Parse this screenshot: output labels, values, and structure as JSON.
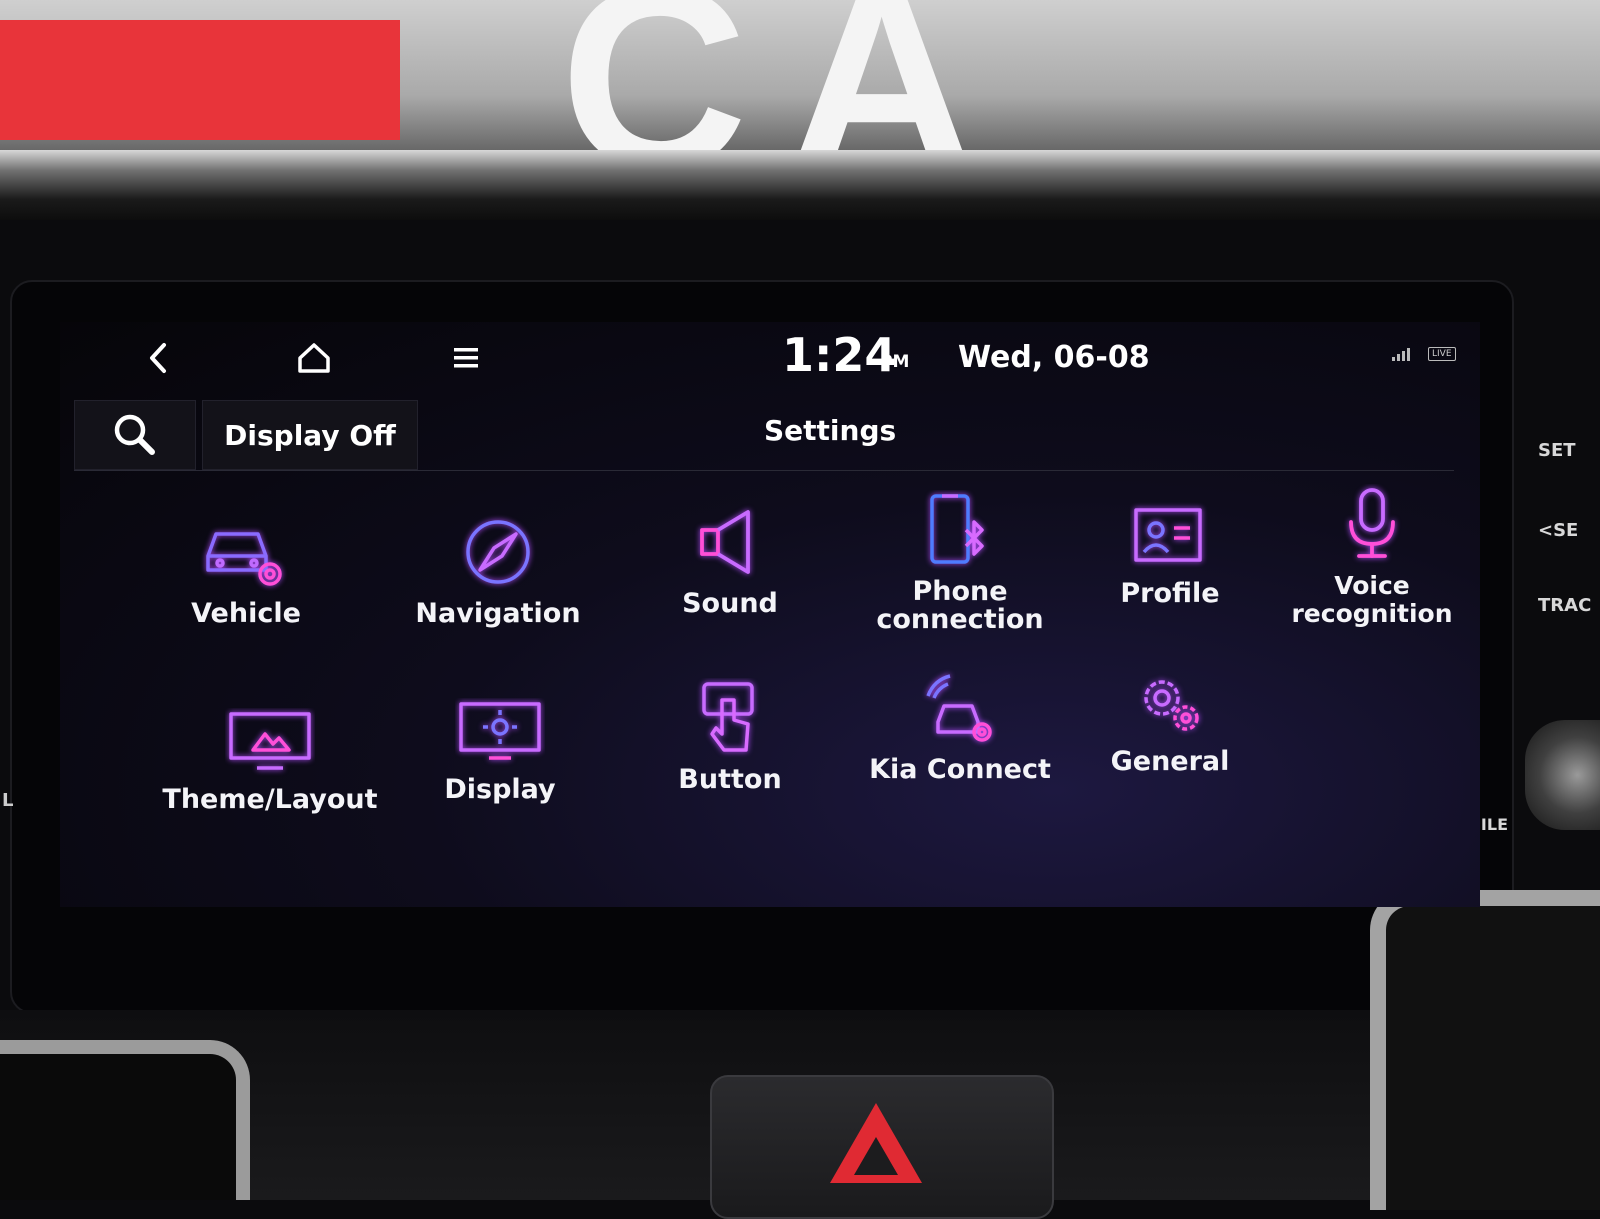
{
  "header": {
    "time": "1:24",
    "ampm": "PM",
    "date": "Wed, 06-08",
    "live_badge": "LIVE"
  },
  "toolbar": {
    "display_off_label": "Display Off",
    "title": "Settings"
  },
  "menu": {
    "items": [
      {
        "label": "Vehicle",
        "icon": "car-gear-icon"
      },
      {
        "label": "Navigation",
        "icon": "compass-icon"
      },
      {
        "label": "Sound",
        "icon": "speaker-icon"
      },
      {
        "label": "Phone\nconnection",
        "icon": "phone-bluetooth-icon"
      },
      {
        "label": "Profile",
        "icon": "profile-card-icon"
      },
      {
        "label": "Voice\nrecognition",
        "icon": "microphone-icon"
      },
      {
        "label": "Theme/Layout",
        "icon": "theme-monitor-icon"
      },
      {
        "label": "Display",
        "icon": "display-brightness-icon"
      },
      {
        "label": "Button",
        "icon": "touch-button-icon"
      },
      {
        "label": "Kia Connect",
        "icon": "connected-car-icon"
      },
      {
        "label": "General",
        "icon": "gears-icon"
      }
    ]
  },
  "dash": {
    "side_labels": [
      "SET",
      "<SE",
      "TRAC",
      "FILE"
    ],
    "side_left": "L"
  },
  "colors": {
    "accent_purple": "#b44dff",
    "accent_pink": "#ff4fd8",
    "accent_blue": "#4f7cff",
    "hazard_red": "#e02a33"
  }
}
